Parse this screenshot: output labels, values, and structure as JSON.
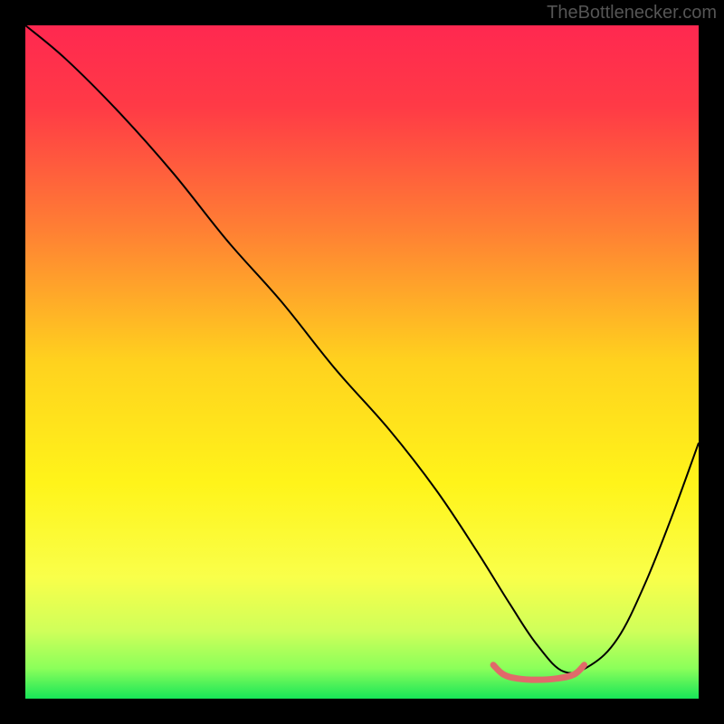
{
  "watermark": "TheBottlenecker.com",
  "chart_data": {
    "type": "line",
    "title": "",
    "xlabel": "",
    "ylabel": "",
    "xlim": [
      0,
      100
    ],
    "ylim": [
      0,
      100
    ],
    "background_gradient": {
      "stops": [
        {
          "offset": 0.0,
          "color": "#ff2850"
        },
        {
          "offset": 0.12,
          "color": "#ff3a46"
        },
        {
          "offset": 0.3,
          "color": "#ff7e34"
        },
        {
          "offset": 0.5,
          "color": "#ffd21e"
        },
        {
          "offset": 0.68,
          "color": "#fff41a"
        },
        {
          "offset": 0.82,
          "color": "#f9ff4a"
        },
        {
          "offset": 0.9,
          "color": "#cfff5a"
        },
        {
          "offset": 0.955,
          "color": "#8bff5a"
        },
        {
          "offset": 1.0,
          "color": "#17e558"
        }
      ]
    },
    "series": [
      {
        "name": "bottleneck-curve",
        "color": "#000000",
        "x": [
          0,
          6,
          14,
          22,
          30,
          38,
          46,
          54,
          61,
          67,
          72,
          76,
          80,
          84,
          88,
          92,
          96,
          100
        ],
        "y": [
          100,
          95,
          87,
          78,
          68,
          59,
          49,
          40,
          31,
          22,
          14,
          8,
          4,
          5,
          9,
          17,
          27,
          38
        ]
      }
    ],
    "optimal_marker": {
      "color": "#e06a6a",
      "x": [
        69.5,
        71,
        73,
        76,
        79,
        81.5,
        83
      ],
      "y": [
        5.0,
        3.6,
        3.0,
        2.8,
        3.0,
        3.6,
        5.0
      ]
    }
  }
}
